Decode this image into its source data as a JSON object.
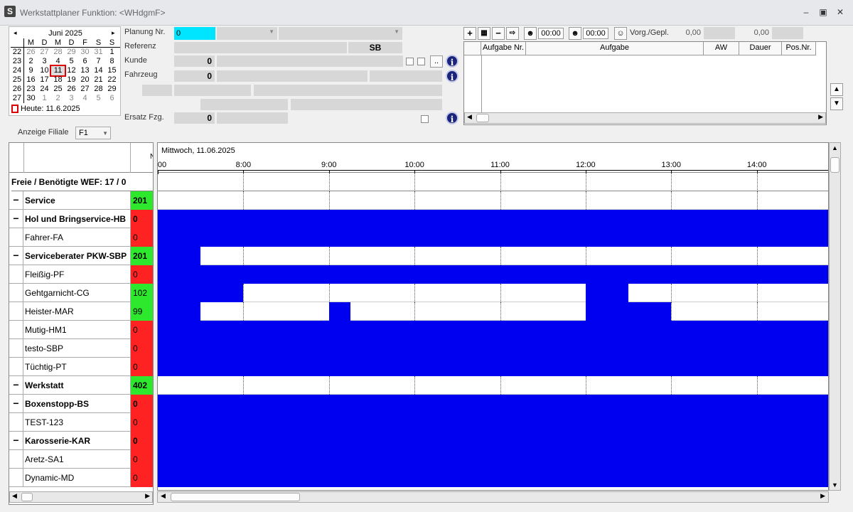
{
  "window": {
    "app_icon": "S",
    "title": "Werkstattplaner  Funktion: <WHdgmF>"
  },
  "calendar": {
    "month_title": "Juni 2025",
    "prev": "◂",
    "next": "▸",
    "weekdays": [
      "M",
      "D",
      "M",
      "D",
      "F",
      "S",
      "S"
    ],
    "weeks": [
      {
        "wk": "22",
        "days": [
          "26",
          "27",
          "28",
          "29",
          "30",
          "31",
          "1"
        ]
      },
      {
        "wk": "23",
        "days": [
          "2",
          "3",
          "4",
          "5",
          "6",
          "7",
          "8"
        ]
      },
      {
        "wk": "24",
        "days": [
          "9",
          "10",
          "11",
          "12",
          "13",
          "14",
          "15"
        ]
      },
      {
        "wk": "25",
        "days": [
          "16",
          "17",
          "18",
          "19",
          "20",
          "21",
          "22"
        ]
      },
      {
        "wk": "26",
        "days": [
          "23",
          "24",
          "25",
          "26",
          "27",
          "28",
          "29"
        ]
      },
      {
        "wk": "27",
        "days": [
          "30",
          "1",
          "2",
          "3",
          "4",
          "5",
          "6"
        ]
      }
    ],
    "today_label": "Heute: 11.6.2025"
  },
  "form": {
    "planung_label": "Planung Nr.",
    "planung_value": "0",
    "referenz_label": "Referenz",
    "referenz_sb": "SB",
    "kunde_label": "Kunde",
    "kunde_value": "0",
    "fahrzeug_label": "Fahrzeug",
    "fahrzeug_value": "0",
    "ersatz_label": "Ersatz Fzg.",
    "ersatz_value": "0",
    "ellipsis": "..",
    "info": "i",
    "filiale_label": "Anzeige Filiale",
    "filiale_value": "F1"
  },
  "toolbar": {
    "time1": "00:00",
    "time2": "00:00",
    "vorg_label": "Vorg./Gepl.",
    "vorg_value1": "0,00",
    "vorg_value2": "0,00"
  },
  "task_table": {
    "columns": [
      "Aufgabe Nr.",
      "Aufgabe",
      "AW",
      "Dauer",
      "Pos.Nr."
    ]
  },
  "left_panel": {
    "header_col": "N",
    "summary": "Freie / Benötigte WEF: 17 / 0",
    "rows": [
      {
        "minus": "−",
        "name": "Service",
        "value": "201",
        "color": "g",
        "bold": true
      },
      {
        "minus": "−",
        "name": "Hol und Bringservice-HB",
        "value": "0",
        "color": "r",
        "bold": true
      },
      {
        "minus": "",
        "name": "Fahrer-FA",
        "value": "0",
        "color": "r",
        "bold": false
      },
      {
        "minus": "−",
        "name": "Serviceberater PKW-SBP",
        "value": "201",
        "color": "g",
        "bold": true
      },
      {
        "minus": "",
        "name": "Fleißig-PF",
        "value": "0",
        "color": "r",
        "bold": false
      },
      {
        "minus": "",
        "name": "Gehtgarnicht-CG",
        "value": "102",
        "color": "g",
        "bold": false
      },
      {
        "minus": "",
        "name": "Heister-MAR",
        "value": "99",
        "color": "g",
        "bold": false
      },
      {
        "minus": "",
        "name": "Mutig-HM1",
        "value": "0",
        "color": "r",
        "bold": false
      },
      {
        "minus": "",
        "name": "testo-SBP",
        "value": "0",
        "color": "r",
        "bold": false
      },
      {
        "minus": "",
        "name": "Tüchtig-PT",
        "value": "0",
        "color": "r",
        "bold": false
      },
      {
        "minus": "−",
        "name": "Werkstatt",
        "value": "402",
        "color": "g",
        "bold": true
      },
      {
        "minus": "−",
        "name": "Boxenstopp-BS",
        "value": "0",
        "color": "r",
        "bold": true
      },
      {
        "minus": "",
        "name": "TEST-123",
        "value": "0",
        "color": "r",
        "bold": false
      },
      {
        "minus": "−",
        "name": "Karosserie-KAR",
        "value": "0",
        "color": "r",
        "bold": true
      },
      {
        "minus": "",
        "name": "Aretz-SA1",
        "value": "0",
        "color": "r",
        "bold": false
      },
      {
        "minus": "",
        "name": "Dynamic-MD",
        "value": "0",
        "color": "r",
        "bold": false
      }
    ]
  },
  "schedule": {
    "date_label": "Mittwoch, 11.06.2025",
    "tick_labels": [
      "00",
      "8:00",
      "9:00",
      "10:00",
      "11:00",
      "12:00",
      "13:00",
      "14:00"
    ],
    "view_start_hour": 7,
    "view_end_hour": 14.85,
    "busy_color": "#0000f0",
    "rows_busy": [
      [],
      [
        [
          7,
          14.85
        ]
      ],
      [
        [
          7,
          14.85
        ]
      ],
      [
        [
          7,
          7.5
        ]
      ],
      [
        [
          7,
          14.85
        ]
      ],
      [
        [
          7,
          8
        ],
        [
          12,
          12.5
        ]
      ],
      [
        [
          7,
          7.5
        ],
        [
          9,
          9.25
        ],
        [
          12,
          13
        ]
      ],
      [
        [
          7,
          14.85
        ]
      ],
      [
        [
          7,
          14.85
        ]
      ],
      [
        [
          7,
          14.85
        ]
      ],
      [],
      [
        [
          7,
          14.85
        ]
      ],
      [
        [
          7,
          14.85
        ]
      ],
      [
        [
          7,
          14.85
        ]
      ],
      [
        [
          7,
          14.85
        ]
      ],
      [
        [
          7,
          14.85
        ]
      ]
    ]
  }
}
